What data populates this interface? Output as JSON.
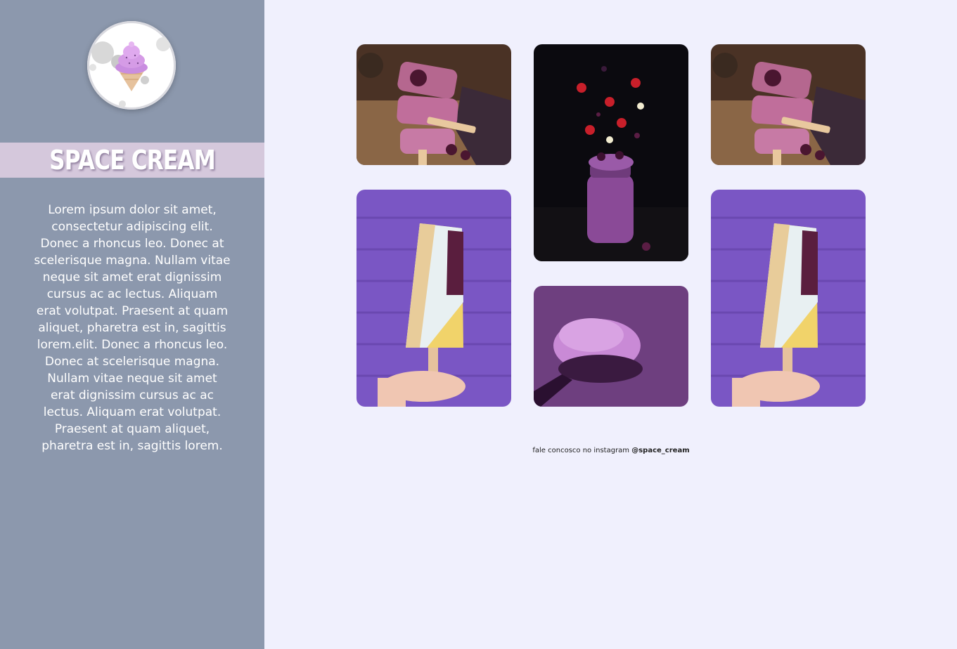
{
  "brand": {
    "title": "SPACE CREAM",
    "logo_icon": "ice-cream-cone-icon"
  },
  "about": {
    "text": "Lorem ipsum dolor sit amet, consectetur adipiscing elit. Donec a rhoncus leo. Donec at scelerisque magna. Nullam vitae neque sit amet erat dignissim cursus ac ac lectus. Aliquam erat volutpat. Praesent at quam aliquet, pharetra est in, sagittis lorem.elit. Donec a rhoncus leo. Donec at scelerisque magna. Nullam vitae neque sit amet erat dignissim cursus ac ac lectus. Aliquam erat volutpat. Praesent at quam aliquet, pharetra est in, sagittis lorem."
  },
  "gallery": [
    {
      "subject": "purple-popsicles-with-berries"
    },
    {
      "subject": "berry-smoothie-jar-with-floating-fruit"
    },
    {
      "subject": "purple-popsicles-with-berries"
    },
    {
      "subject": "nut-coated-popsicle-on-purple-brick-wall"
    },
    {
      "subject": "scoop-of-purple-ice-cream"
    },
    {
      "subject": "nut-coated-popsicle-on-purple-brick-wall"
    }
  ],
  "footer": {
    "prefix": "fale concosco no instagram",
    "handle": "@space_cream"
  },
  "colors": {
    "sidebar": "#8c98ad",
    "title_band": "#d5c8dc",
    "page_background": "#f0f0fd"
  }
}
